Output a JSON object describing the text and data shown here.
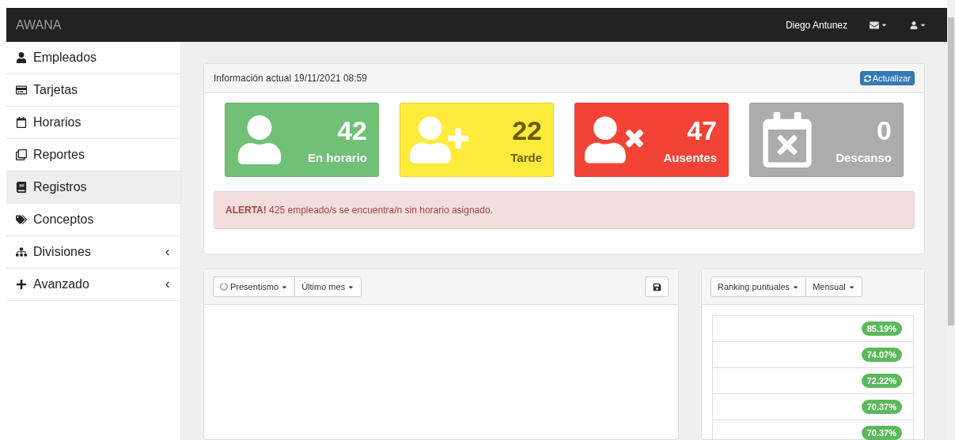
{
  "navbar": {
    "brand": "AWANA",
    "user": "Diego Antunez"
  },
  "sidebar": {
    "items": [
      {
        "label": "Empleados",
        "selected": false,
        "collapsible": false
      },
      {
        "label": "Tarjetas",
        "selected": false,
        "collapsible": false
      },
      {
        "label": "Horarios",
        "selected": false,
        "collapsible": false
      },
      {
        "label": "Reportes",
        "selected": false,
        "collapsible": false
      },
      {
        "label": "Registros",
        "selected": true,
        "collapsible": false
      },
      {
        "label": "Conceptos",
        "selected": false,
        "collapsible": false
      },
      {
        "label": "Divisiones",
        "selected": false,
        "collapsible": true
      },
      {
        "label": "Avanzado",
        "selected": false,
        "collapsible": true
      }
    ]
  },
  "info_panel": {
    "title": "Información actual 19/11/2021 08:59",
    "refresh_button": "Actualizar",
    "cards": [
      {
        "kind": "on_time",
        "count": "42",
        "label": "En horario",
        "color": "#70c175"
      },
      {
        "kind": "late",
        "count": "22",
        "label": "Tarde",
        "color": "#ffeb3b"
      },
      {
        "kind": "absent",
        "count": "47",
        "label": "Ausentes",
        "color": "#f44336"
      },
      {
        "kind": "rest",
        "count": "0",
        "label": "Descanso",
        "color": "#acacac"
      }
    ],
    "alert": "**ALERTA!** 425 empleado/s se encuentra/n sin horario asignado."
  },
  "chart_panel": {
    "dropdowns": [
      "Presentismo",
      "Último mes"
    ]
  },
  "ranking_panel": {
    "dropdowns": [
      "Ranking puntuales",
      "Mensual"
    ],
    "rows": [
      {
        "value": "85.19%"
      },
      {
        "value": "74.07%"
      },
      {
        "value": "72.22%"
      },
      {
        "value": "70.37%"
      },
      {
        "value": "70.37%"
      }
    ]
  }
}
